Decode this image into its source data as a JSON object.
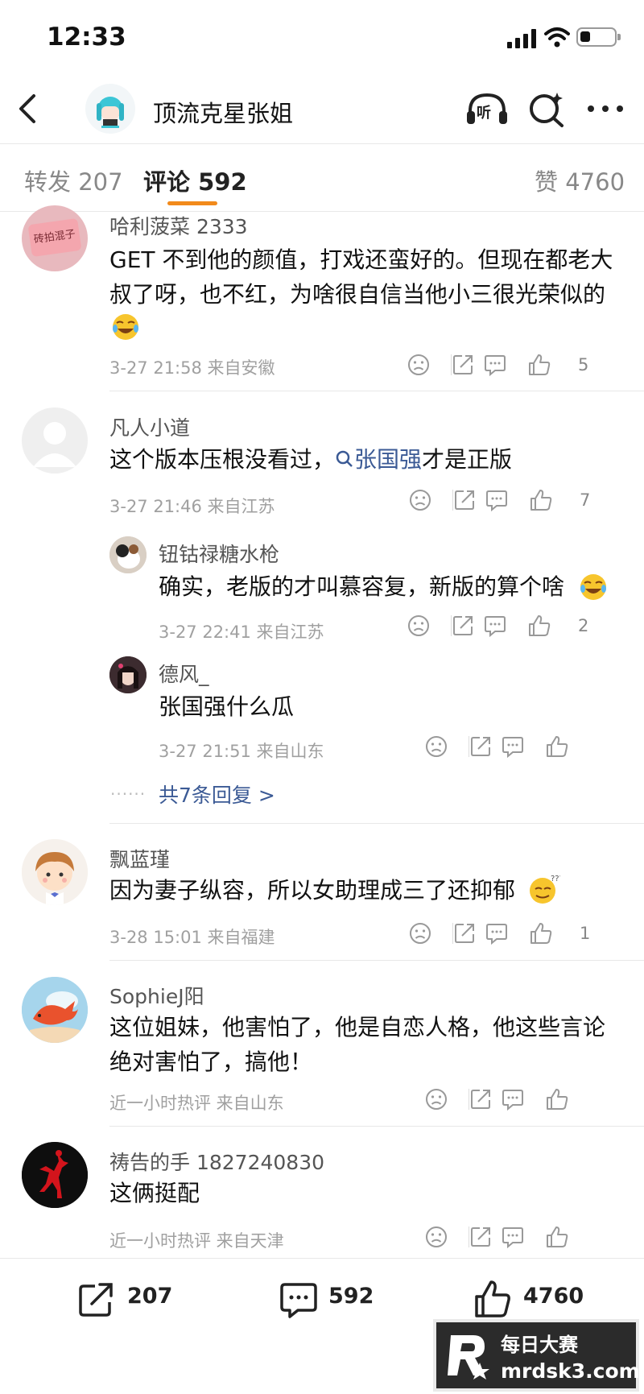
{
  "status_bar": {
    "time": "12:33"
  },
  "nav": {
    "title": "顶流克星张姐",
    "listen_label": "听"
  },
  "tabs": {
    "repost_label": "转发",
    "repost_count": "207",
    "comment_label": "评论",
    "comment_count": "592",
    "like_label": "赞",
    "like_count": "4760"
  },
  "comments": [
    {
      "user": "哈利菠菜 2333",
      "avatar_text": "砖拍混子",
      "text_line1": "GET 不到他的颜值，打戏还蛮好的。但现在都老大",
      "text_line2": "叔了呀，也不红，为啥很自信当他小三很光荣似的",
      "meta": "3-27 21:58  来自安徽",
      "likes": "5"
    },
    {
      "user": "凡人小道",
      "text_pre": "这个版本压根没看过，",
      "topic": "张国强",
      "text_post": "才是正版",
      "meta": "3-27 21:46  来自江苏",
      "likes": "7",
      "replies": [
        {
          "user": "钮钴禄糖水枪",
          "text": "确实，老版的才叫慕容复，新版的算个啥",
          "meta": "3-27 22:41  来自江苏",
          "likes": "2"
        },
        {
          "user": "德风_",
          "text": "张国强什么瓜",
          "meta": "3-27 21:51  来自山东",
          "likes": ""
        }
      ],
      "more_replies": "共7条回复 >"
    },
    {
      "user": "飘蓝瑾",
      "text": "因为妻子纵容，所以女助理成三了还抑郁",
      "meta": "3-28 15:01  来自福建",
      "likes": "1"
    },
    {
      "user": "SophieJ阳",
      "text_line1": "这位姐妹，他害怕了，他是自恋人格，他这些言论",
      "text_line2": "绝对害怕了，搞他！",
      "meta": "近一小时热评  来自山东",
      "likes": ""
    },
    {
      "user": "祷告的手 1827240830",
      "text": "这俩挺配",
      "meta": "近一小时热评  来自天津",
      "likes": ""
    }
  ],
  "bottom_bar": {
    "repost": "207",
    "comment": "592",
    "like": "4760"
  },
  "watermark": {
    "top": "每日大赛",
    "bottom": "mrdsk3.com"
  },
  "colors": {
    "accent": "#f28a1b",
    "link": "#3b5a95"
  }
}
